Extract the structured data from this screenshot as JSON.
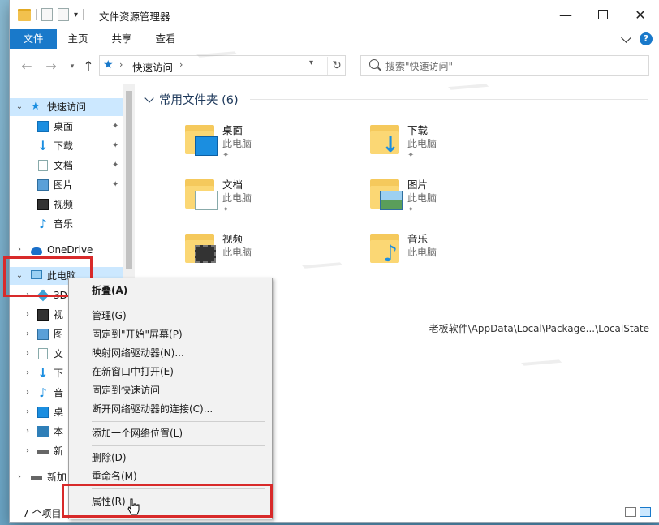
{
  "window": {
    "title": "文件资源管理器",
    "controls": {
      "minimize": "—",
      "maximize": "",
      "close": "✕"
    }
  },
  "ribbon": {
    "tabs": [
      "文件",
      "主页",
      "共享",
      "查看"
    ],
    "help": "?"
  },
  "address": {
    "location": "快速访问",
    "search_placeholder": "搜索\"快速访问\""
  },
  "nav": {
    "quick_access": "快速访问",
    "quick_items": [
      "桌面",
      "下载",
      "文档",
      "图片",
      "视频",
      "音乐"
    ],
    "onedrive": "OneDrive",
    "this_pc": "此电脑",
    "pc_children_partial": [
      "3D",
      "视",
      "图",
      "文",
      "下",
      "音",
      "桌",
      "本",
      "新"
    ],
    "network_partial": "新加"
  },
  "content": {
    "group_title": "常用文件夹 (6)",
    "folders": [
      {
        "name": "桌面",
        "location": "此电脑",
        "icon": "desktop-folder-icon",
        "pinned": true
      },
      {
        "name": "下载",
        "location": "此电脑",
        "icon": "downloads-folder-icon",
        "pinned": true
      },
      {
        "name": "文档",
        "location": "此电脑",
        "icon": "documents-folder-icon",
        "pinned": true
      },
      {
        "name": "图片",
        "location": "此电脑",
        "icon": "pictures-folder-icon",
        "pinned": true
      },
      {
        "name": "视频",
        "location": "此电脑",
        "icon": "videos-folder-icon",
        "pinned": false
      },
      {
        "name": "音乐",
        "location": "此电脑",
        "icon": "music-folder-icon",
        "pinned": false
      }
    ],
    "recent_path": "老板软件\\AppData\\Local\\Package...\\LocalState"
  },
  "status": {
    "item_count": "7 个项目"
  },
  "context_menu": {
    "items": [
      {
        "label": "折叠(A)",
        "bold": true
      },
      {
        "label": "管理(G)"
      },
      {
        "label": "固定到\"开始\"屏幕(P)"
      },
      {
        "label": "映射网络驱动器(N)..."
      },
      {
        "label": "在新窗口中打开(E)"
      },
      {
        "label": "固定到快速访问"
      },
      {
        "label": "断开网络驱动器的连接(C)..."
      },
      {
        "label": "添加一个网络位置(L)"
      },
      {
        "label": "删除(D)"
      },
      {
        "label": "重命名(M)"
      },
      {
        "label": "属性(R)"
      }
    ]
  },
  "colors": {
    "accent": "#1979ca",
    "selection": "#cce8ff",
    "highlight_box": "#d82a2a",
    "folder": "#fbd774"
  }
}
